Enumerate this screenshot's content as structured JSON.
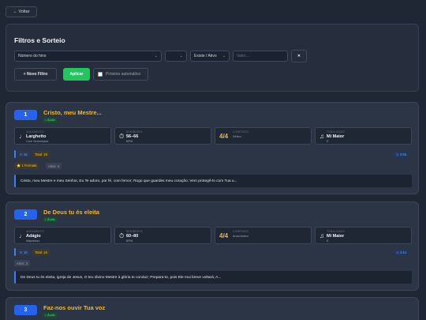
{
  "back_label": "← Voltar",
  "filters": {
    "title": "Filtros e Sorteio",
    "field_select": "Número do hino",
    "operator_select": "",
    "status_select": "Existe / Ativo",
    "value_placeholder": "Valor...",
    "clear_label": "✕",
    "add_filter_label": "+ Novo Filtro",
    "apply_label": "Aplicar",
    "auto_label": "Próximo automático"
  },
  "labels": {
    "andamento": "ANDAMENTO",
    "semibreve": "SEMIBREVE",
    "compasso": "COMPASSO",
    "tonalidade": "TONALIDADE"
  },
  "hymns": [
    {
      "number": "1",
      "title": "Cristo, meu Mestre...",
      "audio": "♪ Áudio",
      "tempo": "Larghetto",
      "tempo_sub": "Com Serenidade",
      "bpm": "56–66",
      "bpm_unit": "BPM",
      "meter": "4/4",
      "meter_sub": "Sêtico",
      "key": "Mi Maior",
      "key_sub": "E",
      "verses": "V: 16",
      "total": "Total: 18",
      "duration": "◷ 2:55",
      "extra_tags": [
        "⭐ 1 Fermata",
        "Ativo: 4"
      ],
      "lyrics": "Cristo, meu Mestre e meu Senhor, Eu Te adoro, por fé, com fervor; Rogo que guardes meu coração; Vem protegê-lo com Tua u..."
    },
    {
      "number": "2",
      "title": "De Deus tu és eleita",
      "audio": "♪ Áudio",
      "tempo": "Adágio",
      "tempo_sub": "Majestoso",
      "bpm": "60–80",
      "bpm_unit": "BPM",
      "meter": "4/4",
      "meter_sub": "Anacrústico",
      "key": "Mi Maior",
      "key_sub": "E",
      "verses": "V: 16",
      "total": "Total: 16",
      "duration": "◷ 2:44",
      "extra_tags": [
        "Ativo: 3"
      ],
      "lyrics": "De Deus tu és eleita, igreja de Jesus, O teu divino Mestre à glória te conduz; Prepara-te, pois Ele mui breve voltará; A..."
    },
    {
      "number": "3",
      "title": "Faz-nos ouvir Tua voz",
      "audio": "♪ Áudio"
    }
  ]
}
